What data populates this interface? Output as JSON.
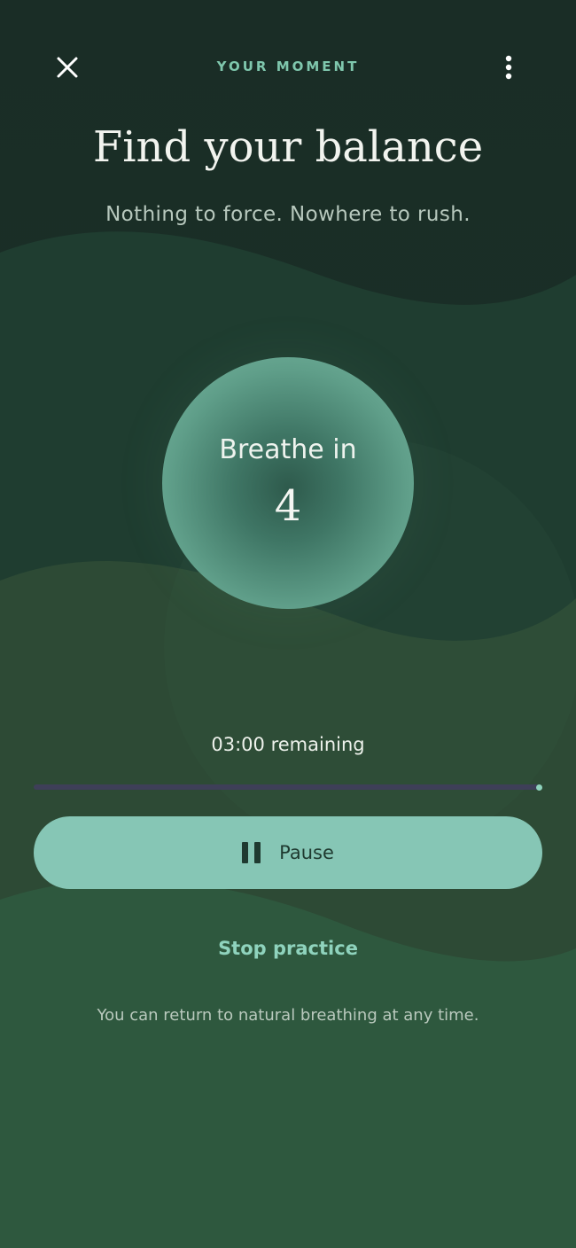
{
  "header": {
    "eyebrow": "YOUR MOMENT",
    "close_icon": "close-icon",
    "menu_icon": "more-vertical-icon"
  },
  "intro": {
    "title": "Find your balance",
    "subtitle": "Nothing to force. Nowhere to rush."
  },
  "breath": {
    "phase": "Breathe in",
    "count": "4"
  },
  "session": {
    "remaining": "03:00 remaining",
    "progress_fraction": 1.0
  },
  "controls": {
    "pause_label": "Pause",
    "pause_icon": "pause-icon",
    "stop_label": "Stop practice"
  },
  "footer": {
    "hint": "You can return to natural breathing at any time."
  },
  "colors": {
    "accent": "#86c6b5",
    "accent_text": "#8fd3bd",
    "background_dark": "#1c2e27",
    "background_green": "#2f583d"
  }
}
